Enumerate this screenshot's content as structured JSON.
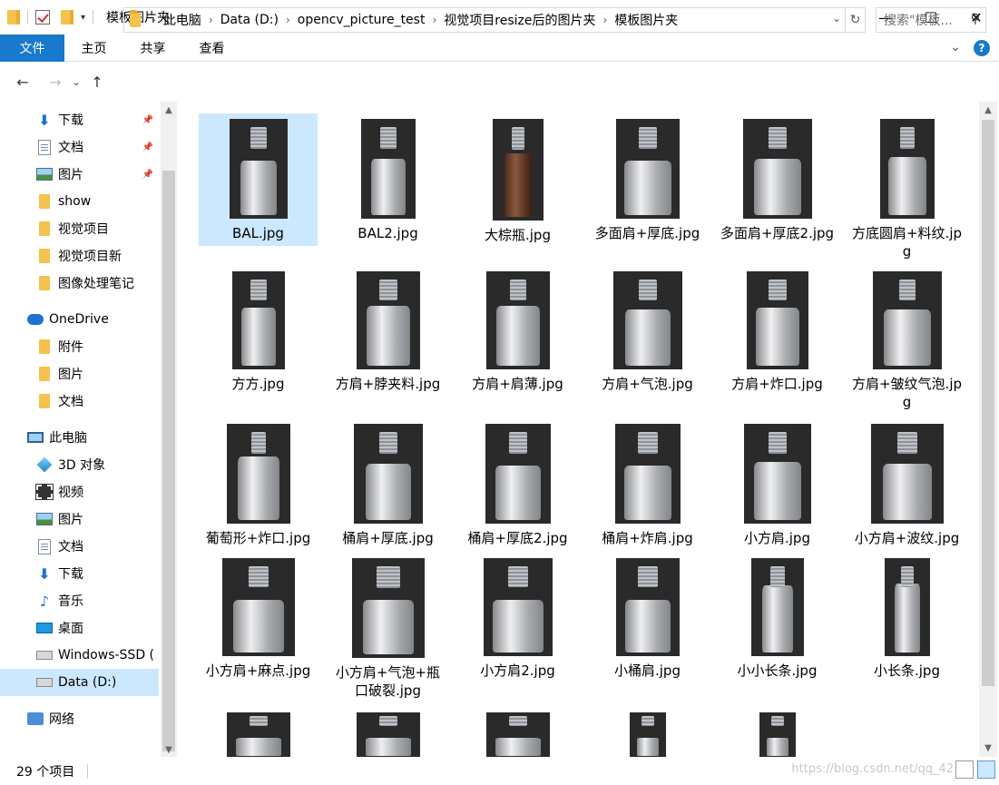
{
  "window": {
    "title": "模板图片夹",
    "controls": [
      "—",
      "☐",
      "✕"
    ]
  },
  "ribbon": {
    "file_tab": "文件",
    "tabs": [
      "主页",
      "共享",
      "查看"
    ]
  },
  "address": {
    "breadcrumbs": [
      "此电脑",
      "Data (D:)",
      "opencv_picture_test",
      "视觉项目resize后的图片夹",
      "模板图片夹"
    ],
    "search_placeholder": "搜索\"模板..."
  },
  "sidebar": {
    "items": [
      {
        "label": "下载",
        "icon": "download-icon",
        "pinned": true
      },
      {
        "label": "文档",
        "icon": "document-icon",
        "pinned": true
      },
      {
        "label": "图片",
        "icon": "picture-icon",
        "pinned": true
      },
      {
        "label": "show",
        "icon": "folder-icon"
      },
      {
        "label": "视觉项目",
        "icon": "folder-icon"
      },
      {
        "label": "视觉项目新",
        "icon": "folder-icon"
      },
      {
        "label": "图像处理笔记",
        "icon": "folder-icon"
      },
      {
        "label": "OneDrive",
        "icon": "cloud-icon"
      },
      {
        "label": "附件",
        "icon": "folder-icon"
      },
      {
        "label": "图片",
        "icon": "folder-icon"
      },
      {
        "label": "文档",
        "icon": "folder-icon"
      },
      {
        "label": "此电脑",
        "icon": "computer-icon"
      },
      {
        "label": "3D 对象",
        "icon": "3d-objects-icon"
      },
      {
        "label": "视频",
        "icon": "video-icon"
      },
      {
        "label": "图片",
        "icon": "picture-icon"
      },
      {
        "label": "文档",
        "icon": "document-icon"
      },
      {
        "label": "下载",
        "icon": "download-icon"
      },
      {
        "label": "音乐",
        "icon": "music-icon"
      },
      {
        "label": "桌面",
        "icon": "desktop-icon"
      },
      {
        "label": "Windows-SSD (",
        "icon": "windows-drive-icon"
      },
      {
        "label": "Data (D:)",
        "icon": "drive-icon",
        "selected": true
      },
      {
        "label": "网络",
        "icon": "network-icon"
      }
    ]
  },
  "files": [
    {
      "name": "BAL.jpg",
      "selected": true
    },
    {
      "name": "BAL2.jpg"
    },
    {
      "name": "大棕瓶.jpg",
      "brown": true
    },
    {
      "name": "多面肩+厚底.jpg"
    },
    {
      "name": "多面肩+厚底2.jpg"
    },
    {
      "name": "方底圆肩+料纹.jpg"
    },
    {
      "name": "方方.jpg"
    },
    {
      "name": "方肩+脖夹料.jpg"
    },
    {
      "name": "方肩+肩薄.jpg"
    },
    {
      "name": "方肩+气泡.jpg"
    },
    {
      "name": "方肩+炸口.jpg"
    },
    {
      "name": "方肩+皱纹气泡.jpg"
    },
    {
      "name": "葡萄形+炸口.jpg"
    },
    {
      "name": "桶肩+厚底.jpg"
    },
    {
      "name": "桶肩+厚底2.jpg"
    },
    {
      "name": "桶肩+炸肩.jpg"
    },
    {
      "name": "小方肩.jpg"
    },
    {
      "name": "小方肩+波纹.jpg"
    },
    {
      "name": "小方肩+麻点.jpg"
    },
    {
      "name": "小方肩+气泡+瓶口破裂.jpg"
    },
    {
      "name": "小方肩2.jpg"
    },
    {
      "name": "小桶肩.jpg"
    },
    {
      "name": "小小长条.jpg"
    },
    {
      "name": "小长条.jpg"
    },
    {
      "name": ""
    },
    {
      "name": ""
    },
    {
      "name": ""
    },
    {
      "name": ""
    },
    {
      "name": ""
    }
  ],
  "status": {
    "count": "29 个项目"
  },
  "watermark": "https://blog.csdn.net/qq_42"
}
